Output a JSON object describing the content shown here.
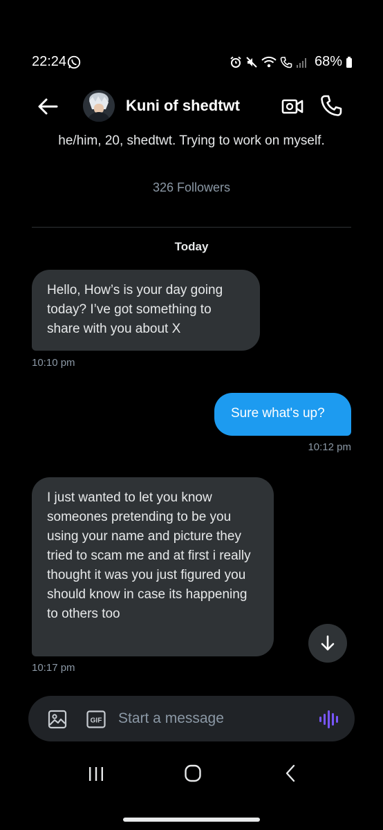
{
  "status_bar": {
    "time": "22:24",
    "battery": "68%",
    "icons": [
      "whatsapp-icon",
      "alarm-icon",
      "mute-icon",
      "wifi-icon",
      "wifi-call-icon",
      "signal-icon",
      "battery-icon"
    ]
  },
  "header": {
    "display_name": "Kuni of shedtwt",
    "icons": [
      "back-arrow-icon",
      "video-call-icon",
      "phone-icon"
    ]
  },
  "profile": {
    "bio": "he/him, 20, shedtwt. Trying to work on myself.",
    "followers": "326 Followers"
  },
  "conversation": {
    "day_label": "Today",
    "messages": [
      {
        "direction": "incoming",
        "text": "Hello, How’s is your day going today? I’ve got something to share with you about X",
        "time": "10:10 pm"
      },
      {
        "direction": "outgoing",
        "text": "Sure what's up?",
        "time": "10:12 pm"
      },
      {
        "direction": "incoming",
        "text": "I just wanted to let you know someones pretending to be you using your name and picture they tried to scam me and at first i really thought it was you just figured you should know in case its happening to others too",
        "time": "10:17 pm"
      }
    ]
  },
  "composer": {
    "placeholder": "Start a message",
    "gif_label": "GIF"
  },
  "colors": {
    "background": "#000000",
    "incoming_bubble": "#2f3336",
    "outgoing_bubble": "#1d9bf0",
    "muted_text": "#8b98a5",
    "voice_accent": "#7856ff"
  }
}
